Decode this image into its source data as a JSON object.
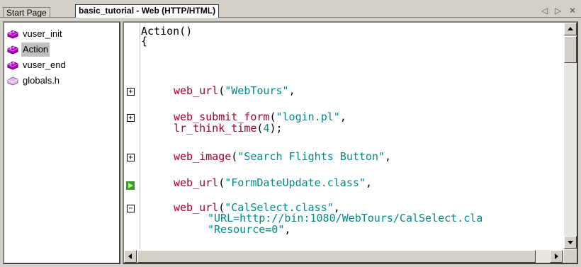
{
  "tabs": [
    {
      "label": "Start Page",
      "active": false
    },
    {
      "label": "basic_tutorial - Web (HTTP/HTML)",
      "active": true
    }
  ],
  "tab_controls": {
    "prev": "◁",
    "next": "▷",
    "close": "✕"
  },
  "tree": {
    "items": [
      {
        "label": "vuser_init",
        "icon": "action-brick-icon",
        "selected": false
      },
      {
        "label": "Action",
        "icon": "action-brick-icon",
        "selected": true
      },
      {
        "label": "vuser_end",
        "icon": "action-brick-icon",
        "selected": false
      },
      {
        "label": "globals.h",
        "icon": "header-file-icon",
        "selected": false
      }
    ]
  },
  "editor": {
    "lines": [
      {
        "plain": "Action()"
      },
      {
        "plain": "{"
      },
      {
        "fn": "web_url",
        "str": "\"WebTours\"",
        "tail": ","
      },
      {
        "fn": "web_submit_form",
        "str": "\"login.pl\"",
        "tail": ","
      },
      {
        "fn": "lr_think_time",
        "num": "4",
        "tail": ");"
      },
      {
        "fn": "web_image",
        "str": "\"Search Flights Button\"",
        "tail": ","
      },
      {
        "fn": "web_url",
        "str": "\"FormDateUpdate.class\"",
        "tail": ","
      },
      {
        "fn": "web_url",
        "str": "\"CalSelect.class\"",
        "tail": ","
      },
      {
        "str": "\"URL=http://bin:1080/WebTours/CalSelect.cla"
      },
      {
        "str": "\"Resource=0\"",
        "tail": ","
      }
    ]
  },
  "colors": {
    "function": "#a0002a",
    "string": "#008a8a",
    "selection": "#c0c0c0"
  }
}
